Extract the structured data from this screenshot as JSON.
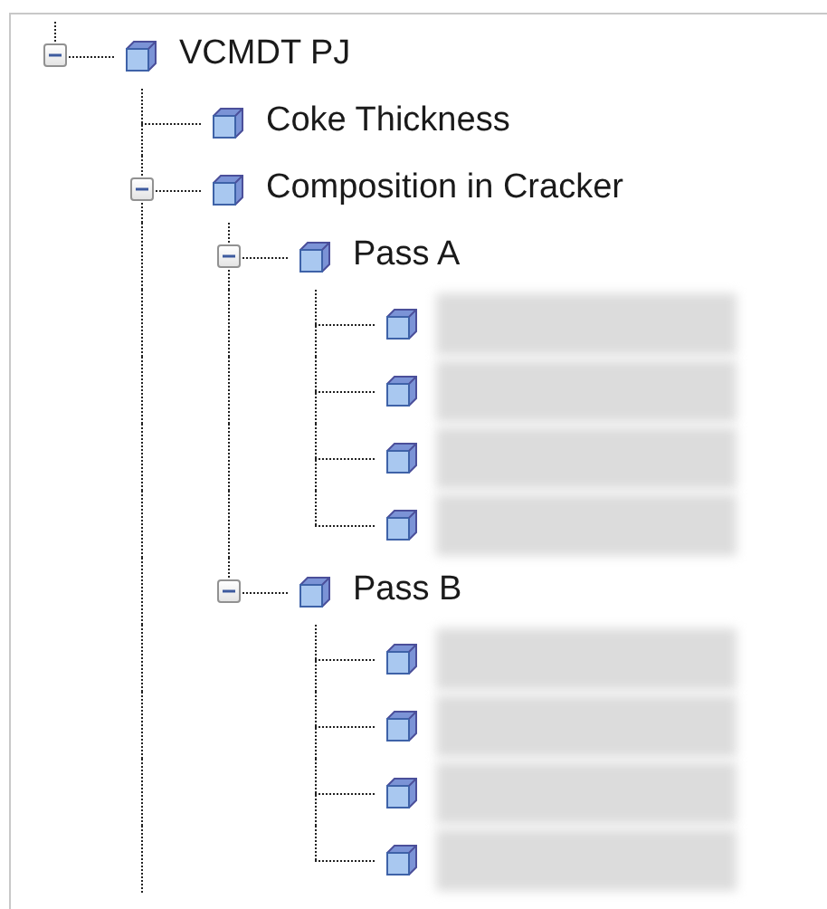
{
  "tree": [
    {
      "kind": "node",
      "label": "VCMDT PJ",
      "expanded": true,
      "continues_below": true,
      "children": [
        {
          "kind": "node",
          "label": "Coke Thickness"
        },
        {
          "kind": "node",
          "label": "Composition in Cracker",
          "expanded": true,
          "children": [
            {
              "kind": "node",
              "label": "Pass A",
              "expanded": true,
              "children": [
                {
                  "kind": "blurred"
                },
                {
                  "kind": "blurred"
                },
                {
                  "kind": "blurred"
                },
                {
                  "kind": "blurred"
                }
              ]
            },
            {
              "kind": "node",
              "label": "Pass B",
              "expanded": true,
              "children": [
                {
                  "kind": "blurred"
                },
                {
                  "kind": "blurred"
                },
                {
                  "kind": "blurred"
                },
                {
                  "kind": "blurred"
                }
              ]
            }
          ]
        }
      ]
    }
  ]
}
